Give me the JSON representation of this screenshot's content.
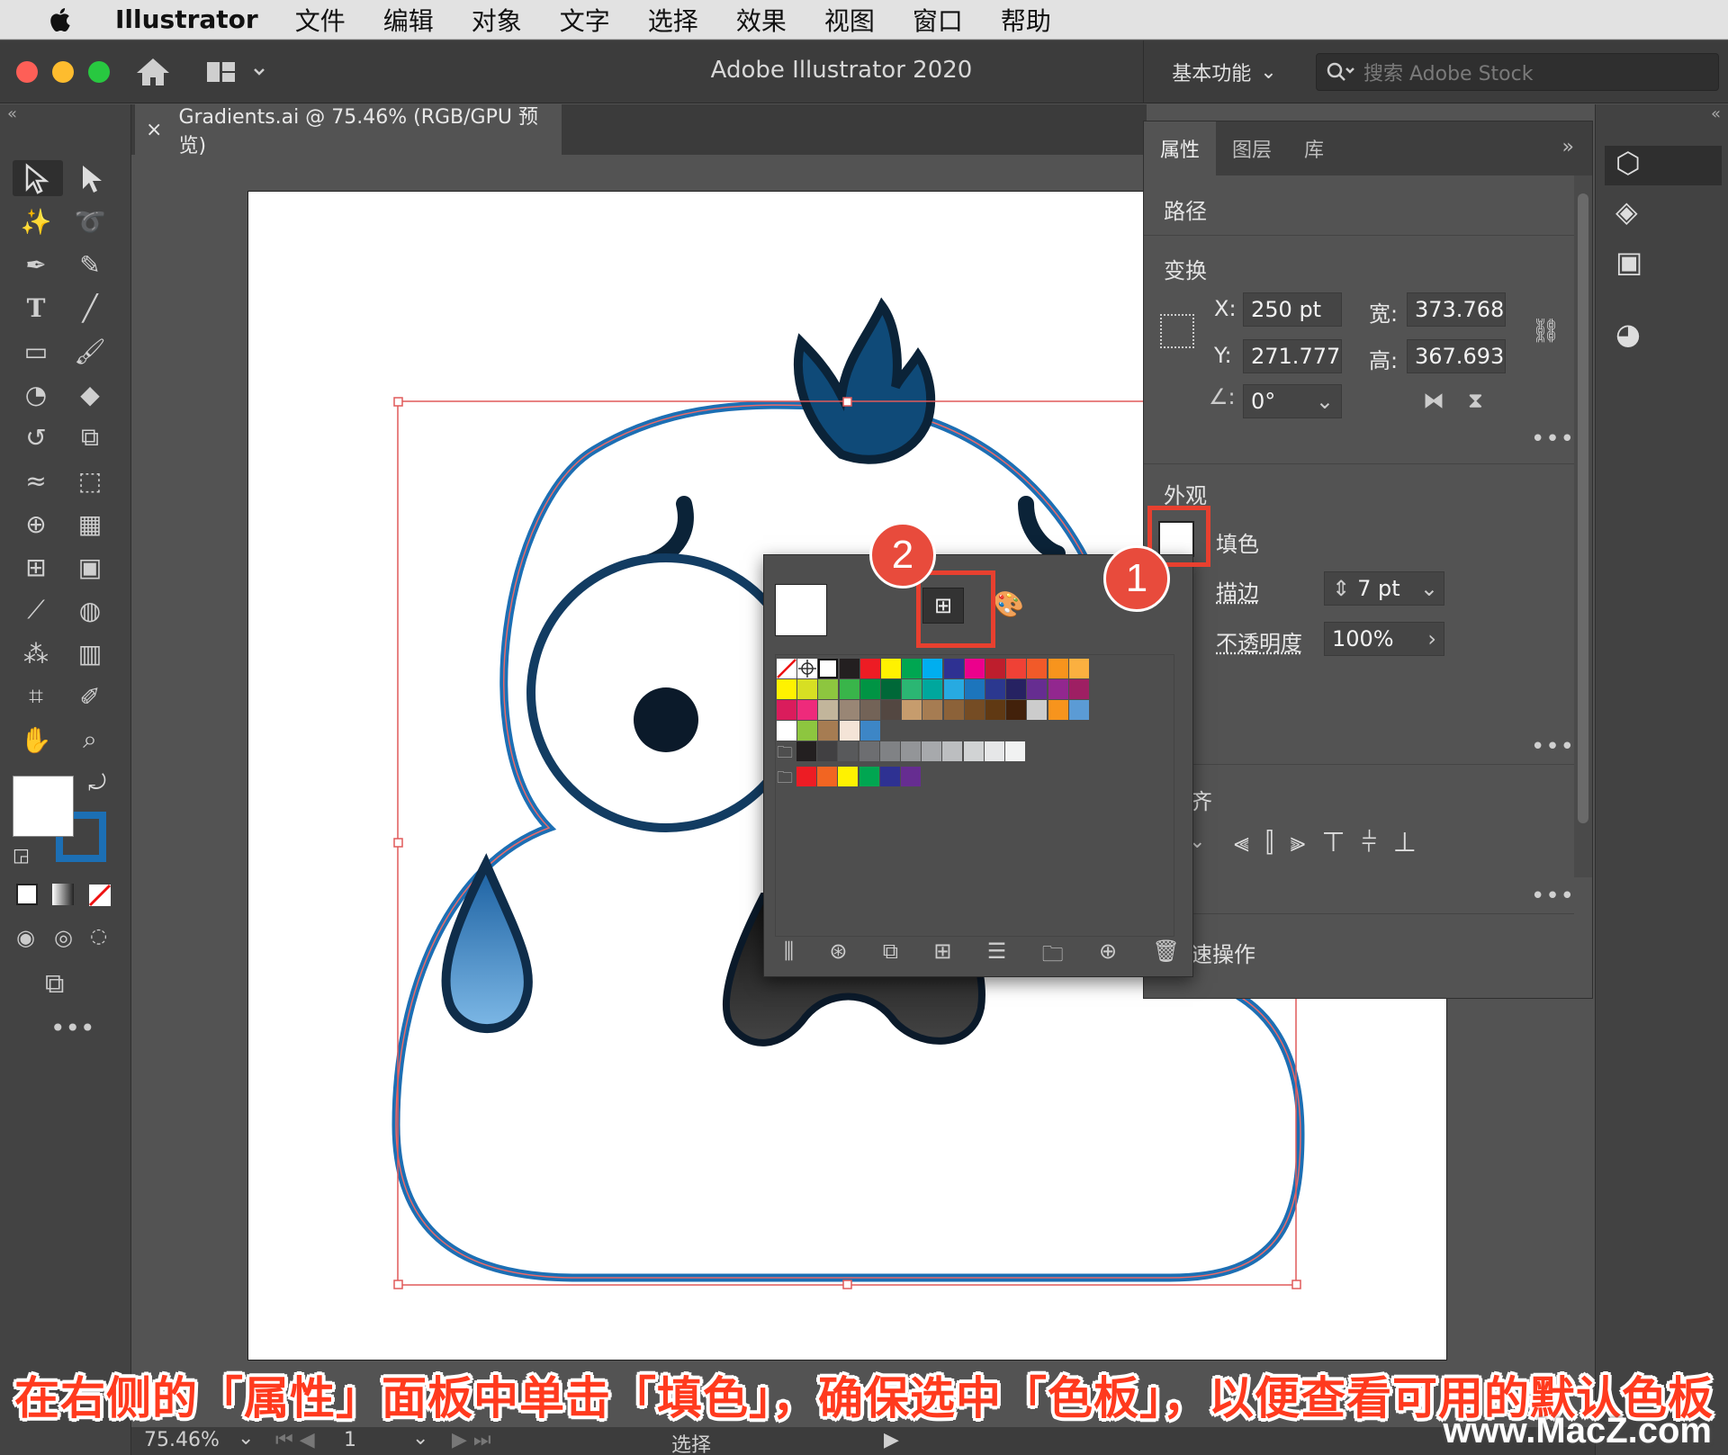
{
  "menubar": {
    "app": "Illustrator",
    "items": [
      "文件",
      "编辑",
      "对象",
      "文字",
      "选择",
      "效果",
      "视图",
      "窗口",
      "帮助"
    ]
  },
  "titlebar": {
    "title": "Adobe Illustrator 2020",
    "workspace": "基本功能",
    "stock_placeholder": "搜索 Adobe Stock"
  },
  "document": {
    "tab_label": "Gradients.ai @ 75.46% (RGB/GPU 预览)"
  },
  "properties": {
    "tabs": [
      "属性",
      "图层",
      "库"
    ],
    "selection_type": "路径",
    "transform": {
      "title": "变换",
      "x_label": "X:",
      "x": "250 pt",
      "y_label": "Y:",
      "y": "271.777",
      "w_label": "宽:",
      "w": "373.768",
      "h_label": "高:",
      "h": "367.693",
      "angle": "0°"
    },
    "appearance": {
      "title": "外观",
      "fill_label": "填色",
      "stroke_label": "描边",
      "stroke_value": "7 pt",
      "opacity_label": "不透明度",
      "opacity_value": "100%"
    },
    "align_title_partial": "齐",
    "quick_actions_partial": "速操作"
  },
  "swatches": {
    "row1": [
      "#ffffff",
      "#ffffff",
      "#ffffff",
      "#231f20",
      "#ed1c24",
      "#fff200",
      "#00a651",
      "#00aeef",
      "#2e3192",
      "#ec008c",
      "#be1e2d",
      "#ef4136",
      "#f15a29",
      "#f7941d",
      "#fbb040"
    ],
    "row2": [
      "#fff200",
      "#d7df23",
      "#8dc63f",
      "#39b54a",
      "#009444",
      "#006838",
      "#2bb673",
      "#00a79d",
      "#27aae1",
      "#1c75bc",
      "#2b388f",
      "#262262",
      "#662d91",
      "#92278f",
      "#9e1f63"
    ],
    "row3": [
      "#da1c5c",
      "#ee2a7b",
      "#c2b59b",
      "#998675",
      "#736357",
      "#534741",
      "#c69c6d",
      "#a67c52",
      "#8c6239",
      "#754c24",
      "#603913",
      "#42210b",
      "#cccccc",
      "#f7941d",
      "#5b9bd5"
    ],
    "row4": [
      "#ffffff",
      "#8dc63f",
      "#a67c52",
      "#f4e4d7",
      "#3d86c6"
    ],
    "row5": [
      "#231f20",
      "#414042",
      "#58595b",
      "#6d6e71",
      "#808285",
      "#939598",
      "#a7a9ac",
      "#bcbec0",
      "#d1d3d4",
      "#e6e7e8",
      "#f1f2f2"
    ],
    "row6": [
      "#ed1c24",
      "#f26522",
      "#fff200",
      "#00a651",
      "#2e3192",
      "#662d91"
    ]
  },
  "annotations": {
    "badge1": "1",
    "badge2": "2",
    "caption": "在右侧的「属性」面板中单击「填色」，确保选中「色板」，以便查看可用的默认色板"
  },
  "status": {
    "zoom": "75.46%",
    "artboard": "1",
    "tool": "选择"
  },
  "watermark": "www.MacZ.com",
  "colors": {
    "accent": "#1c6fb4",
    "annotation": "#e84b3c",
    "dark_navy": "#0f2d4a"
  }
}
